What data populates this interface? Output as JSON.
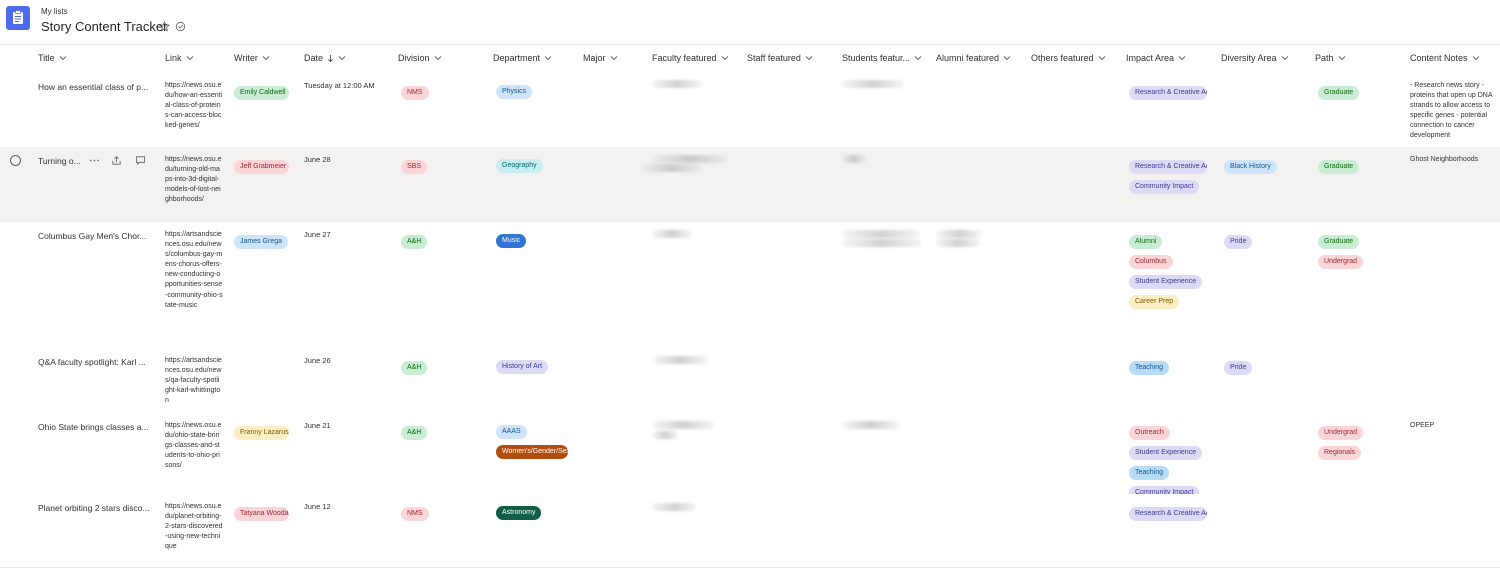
{
  "header": {
    "breadcrumb": "My lists",
    "title": "Story Content Tracker",
    "icons": [
      "list-app-icon",
      "favorite-star-icon",
      "info-check-icon"
    ]
  },
  "columns": [
    {
      "key": "title",
      "label": "Title"
    },
    {
      "key": "link",
      "label": "Link"
    },
    {
      "key": "writer",
      "label": "Writer"
    },
    {
      "key": "date",
      "label": "Date"
    },
    {
      "key": "division",
      "label": "Division"
    },
    {
      "key": "department",
      "label": "Department"
    },
    {
      "key": "major",
      "label": "Major"
    },
    {
      "key": "faculty",
      "label": "Faculty featured"
    },
    {
      "key": "staff",
      "label": "Staff featured"
    },
    {
      "key": "students",
      "label": "Students featur..."
    },
    {
      "key": "alumni",
      "label": "Alumni featured"
    },
    {
      "key": "others",
      "label": "Others featured"
    },
    {
      "key": "impact",
      "label": "Impact Area"
    },
    {
      "key": "diversity",
      "label": "Diversity Area"
    },
    {
      "key": "path",
      "label": "Path"
    },
    {
      "key": "notes",
      "label": "Content Notes"
    }
  ],
  "sort": {
    "column": "date",
    "direction": "descending",
    "icon": "arrow-down-icon"
  },
  "colors": {
    "app_icon": "#4f6bed",
    "tag_nms": "#f9d5d8",
    "tag_sbs": "#f9d5d8",
    "tag_ah": "#c9ecd4",
    "tag_blue": "#cfe4fa",
    "tag_purple": "#dcdaf5",
    "tag_green": "#c9ecd4",
    "tag_red": "#f9d5d8",
    "tag_yellow": "#fbeec2",
    "music": "#2f73d3",
    "womens": "#b34d0f",
    "astronomy": "#105e46"
  },
  "rows": [
    {
      "title": "How an essential class of p...",
      "link": "https://news.osu.edu/how-an-essential-class-of-proteins-can-access-blocked-genes/",
      "writer": "Emily Caldwell",
      "date": "Tuesday at 12:00 AM",
      "division": "NMS",
      "department": [
        "Physics"
      ],
      "impact": [
        "Research & Creative Activity"
      ],
      "diversity": [],
      "path": [
        "Graduate"
      ],
      "notes": "- Research news story - proteins that open up DNA strands to allow access to specific genes - potential connection to cancer development"
    },
    {
      "title": "Turning o...",
      "link": "https://news.osu.edu/turning-old-maps-into-3d-digital-models-of-lost-neighborhoods/",
      "writer": "Jeff Grabmeier",
      "date": "June 28",
      "division": "SBS",
      "department": [
        "Geography"
      ],
      "impact": [
        "Research & Creative Activity",
        "Community Impact"
      ],
      "diversity": [
        "Black History"
      ],
      "path": [
        "Graduate"
      ],
      "notes": "Ghost Neighborhoods"
    },
    {
      "title": "Columbus Gay Men's Chor...",
      "link": "https://artsandsciences.osu.edu/news/columbus-gay-mens-chorus-offers-new-conducting-opportunities-sense-community-ohio-state-music",
      "writer": "James Grega",
      "date": "June 27",
      "division": "A&H",
      "department": [
        "Music"
      ],
      "impact": [
        "Alumni",
        "Columbus",
        "Student Experience",
        "Career Prep"
      ],
      "diversity": [
        "Pride"
      ],
      "path": [
        "Graduate",
        "Undergrad"
      ],
      "notes": ""
    },
    {
      "title": "Q&A faculty spotlight: Karl ...",
      "link": "https://artsandsciences.osu.edu/news/qa-faculty-spotlight-karl-whittington",
      "writer": "",
      "date": "June 26",
      "division": "A&H",
      "department": [
        "History of Art"
      ],
      "impact": [
        "Teaching"
      ],
      "diversity": [
        "Pride"
      ],
      "path": [],
      "notes": ""
    },
    {
      "title": "Ohio State brings classes a...",
      "link": "https://news.osu.edu/ohio-state-brings-classes-and-students-to-ohio-prisons/",
      "writer": "Franny Lazarus",
      "date": "June 21",
      "division": "A&H",
      "department": [
        "AAAS",
        "Women's/Gender/Sexuality Studies"
      ],
      "impact": [
        "Outreach",
        "Student Experience",
        "Teaching",
        "Community Impact"
      ],
      "diversity": [],
      "path": [
        "Undergrad",
        "Regionals"
      ],
      "notes": "OPEEP"
    },
    {
      "title": "Planet orbiting 2 stars disco...",
      "link": "https://news.osu.edu/planet-orbiting-2-stars-discovered-using-new-technique",
      "writer": "Tatyana Woodall",
      "date": "June 12",
      "division": "NMS",
      "department": [
        "Astronomy"
      ],
      "impact": [
        "Research & Creative Activity"
      ],
      "diversity": [],
      "path": [],
      "notes": ""
    }
  ]
}
